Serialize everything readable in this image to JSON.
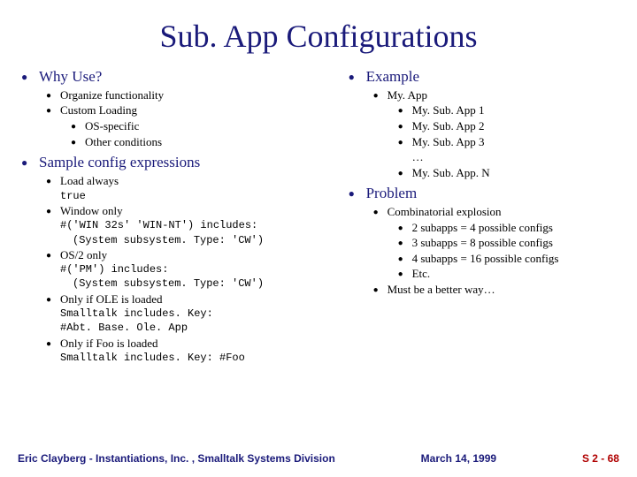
{
  "title": "Sub. App Configurations",
  "left": {
    "h1": "Why Use?",
    "organize": "Organize functionality",
    "custom": "Custom Loading",
    "os": "OS-specific",
    "other": "Other conditions",
    "h2": "Sample config expressions",
    "la": "Load always",
    "la2": "true",
    "wo": "Window only",
    "wo2": "#('WIN 32s' 'WIN-NT') includes:",
    "wo3": "(System subsystem. Type: 'CW')",
    "os2a": "OS/2 only",
    "os2b": "#('PM') includes:",
    "os2c": "(System subsystem. Type: 'CW')",
    "ole": "Only if OLE is loaded",
    "ole2": "Smalltalk includes. Key:",
    "ole3": "#Abt. Base. Ole. App",
    "foo": "Only if Foo is loaded",
    "foo2": "Smalltalk includes. Key: #Foo"
  },
  "right": {
    "h1": "Example",
    "myapp": "My. App",
    "s1": "My. Sub. App 1",
    "s2": "My. Sub. App 2",
    "s3": "My. Sub. App 3",
    "dots": "…",
    "sn": "My. Sub. App. N",
    "h2": "Problem",
    "ce": "Combinatorial explosion",
    "c2": "2 subapps = 4 possible configs",
    "c3": "3 subapps = 8 possible configs",
    "c4": "4 subapps = 16 possible configs",
    "etc": "Etc.",
    "must": "Must be a better way…"
  },
  "footer": {
    "author": "Eric Clayberg - Instantiations, Inc. , Smalltalk Systems Division",
    "date": "March 14, 1999",
    "page": "S 2 - 68"
  }
}
